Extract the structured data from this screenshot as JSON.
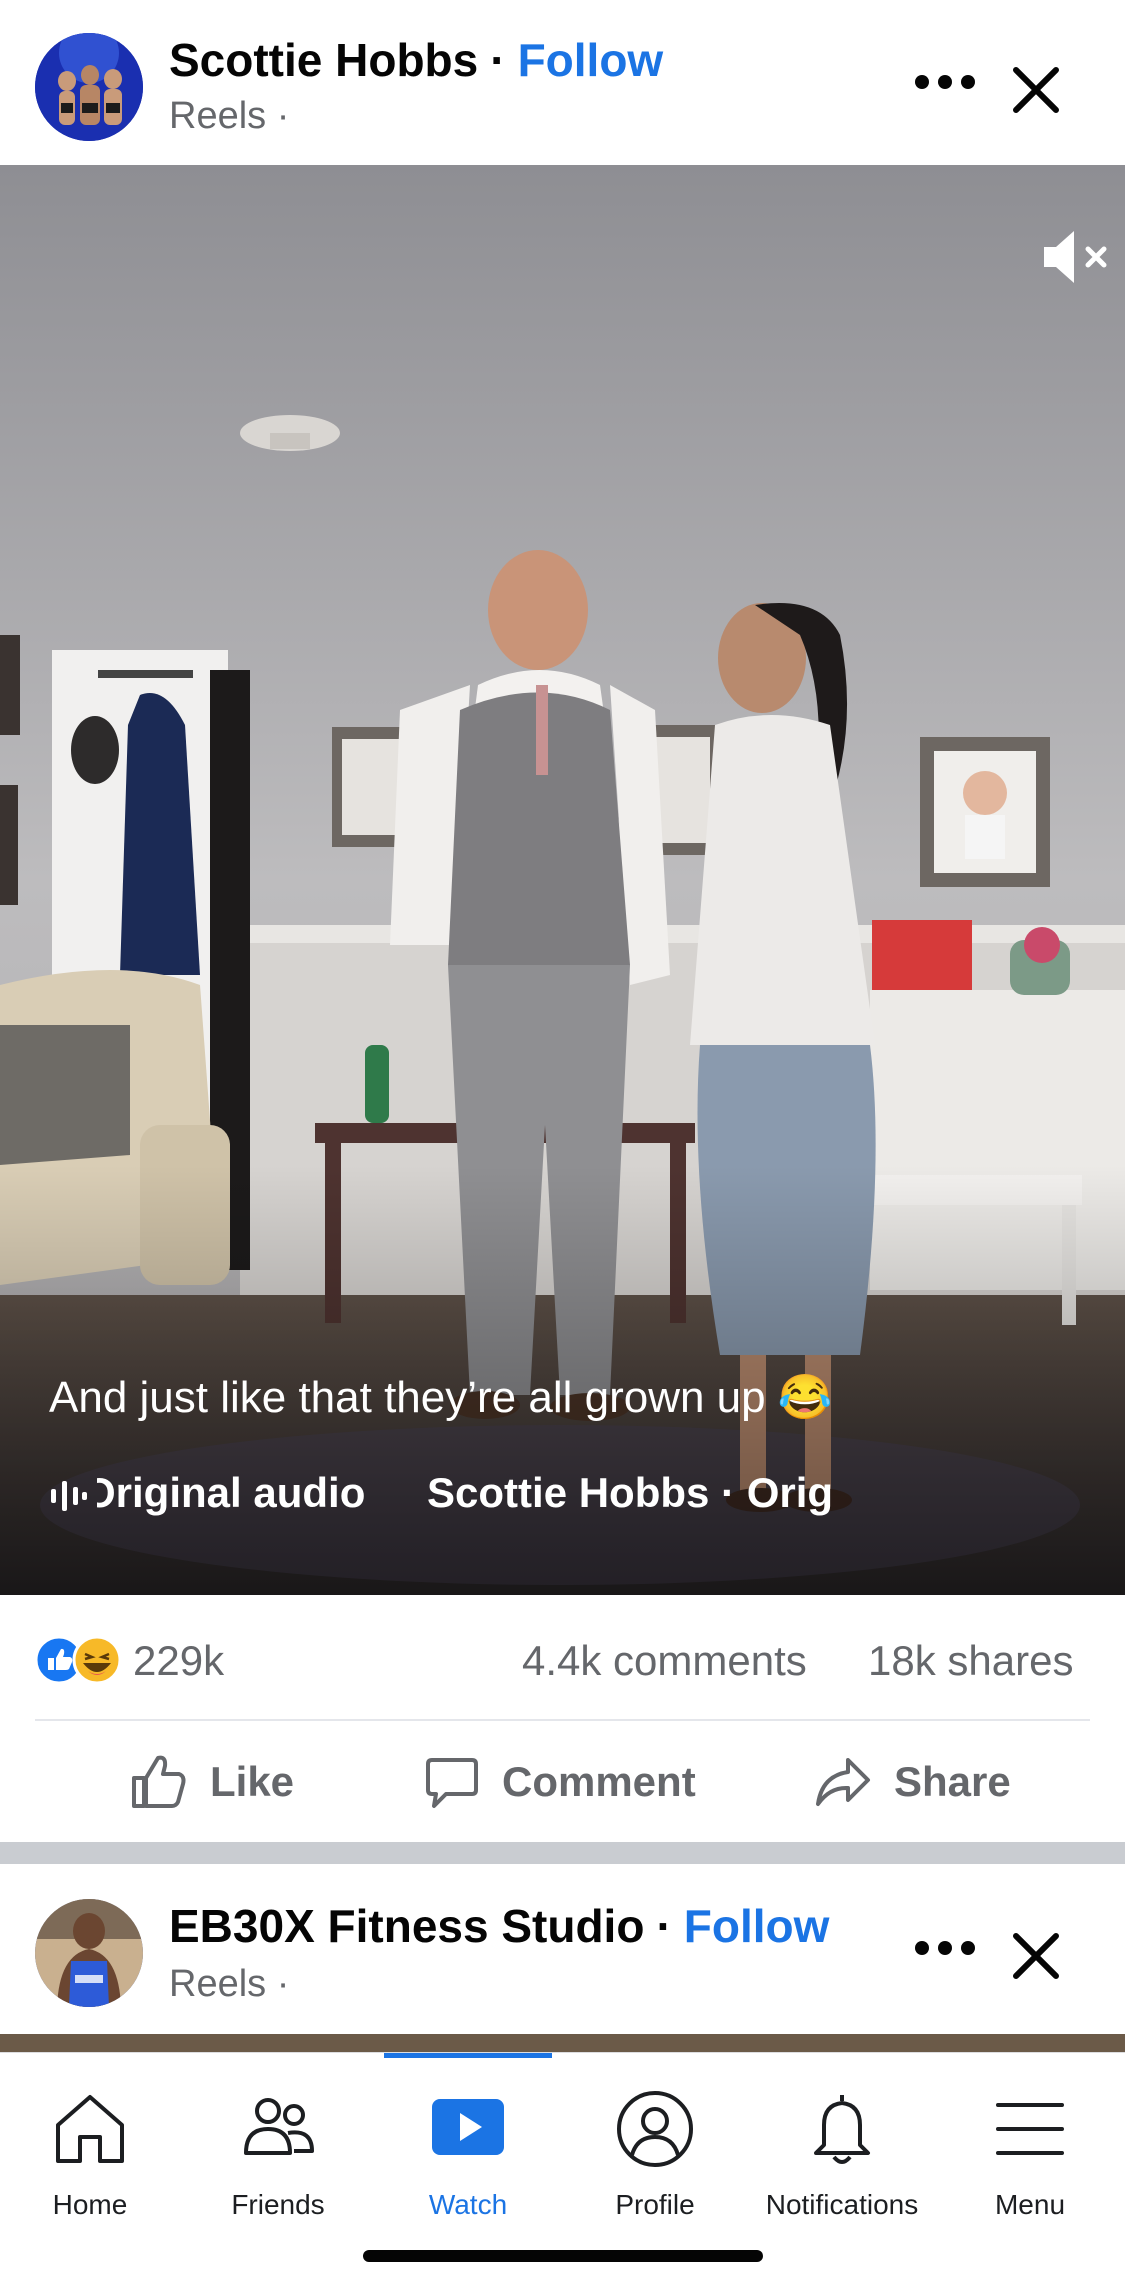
{
  "post1": {
    "author": "Scottie Hobbs",
    "dot": "·",
    "follow_label": "Follow",
    "subtitle": "Reels ·",
    "caption": "And just like that they’re all grown up 😂",
    "audio_label": "Original audio",
    "audio_source": "Scottie Hobbs · Orig",
    "reaction_count": "229k",
    "comments": "4.4k comments",
    "shares": "18k shares"
  },
  "actions": {
    "like": "Like",
    "comment": "Comment",
    "share": "Share"
  },
  "post2": {
    "author": "EB30X Fitness Studio",
    "dot": "·",
    "follow_label": "Follow",
    "subtitle": "Reels ·"
  },
  "tabs": [
    {
      "label": "Home",
      "icon": "home-icon"
    },
    {
      "label": "Friends",
      "icon": "friends-icon"
    },
    {
      "label": "Watch",
      "icon": "watch-icon",
      "active": true
    },
    {
      "label": "Profile",
      "icon": "profile-icon"
    },
    {
      "label": "Notifications",
      "icon": "bell-icon"
    },
    {
      "label": "Menu",
      "icon": "menu-icon"
    }
  ],
  "colors": {
    "accent": "#1b74e4",
    "secondary_text": "#65676b",
    "like_blue": "#1877f2",
    "haha_yellow": "#f7b928"
  }
}
